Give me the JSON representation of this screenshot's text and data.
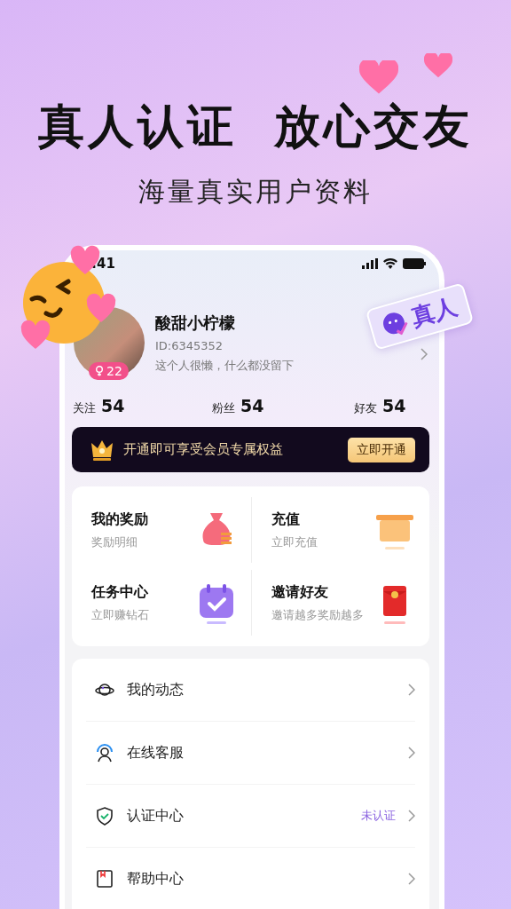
{
  "headline": [
    "真人认证",
    "放心交友"
  ],
  "subtitle": "海量真实用户资料",
  "status_bar": {
    "time": ":41"
  },
  "profile": {
    "name": "酸甜小柠檬",
    "id": "ID:6345352",
    "bio": "这个人很懒，什么都没留下",
    "age": "22"
  },
  "badge": {
    "label": "真人"
  },
  "stats": [
    {
      "label": "关注",
      "value": "54"
    },
    {
      "label": "粉丝",
      "value": "54"
    },
    {
      "label": "好友",
      "value": "54"
    }
  ],
  "vip_banner": {
    "text": "开通即可享受会员专属权益",
    "button": "立即开通"
  },
  "shortcuts": [
    {
      "title": "我的奖励",
      "subtitle": "奖励明细",
      "kind": "bag"
    },
    {
      "title": "充值",
      "subtitle": "立即充值",
      "kind": "box"
    },
    {
      "title": "任务中心",
      "subtitle": "立即赚钻石",
      "kind": "calendar"
    },
    {
      "title": "邀请好友",
      "subtitle": "邀请越多奖励越多",
      "kind": "envelope"
    }
  ],
  "menu": [
    {
      "label": "我的动态",
      "kind": "planet"
    },
    {
      "label": "在线客服",
      "kind": "headset"
    },
    {
      "label": "认证中心",
      "kind": "shield",
      "status": "未认证"
    },
    {
      "label": "帮助中心",
      "kind": "book"
    }
  ]
}
